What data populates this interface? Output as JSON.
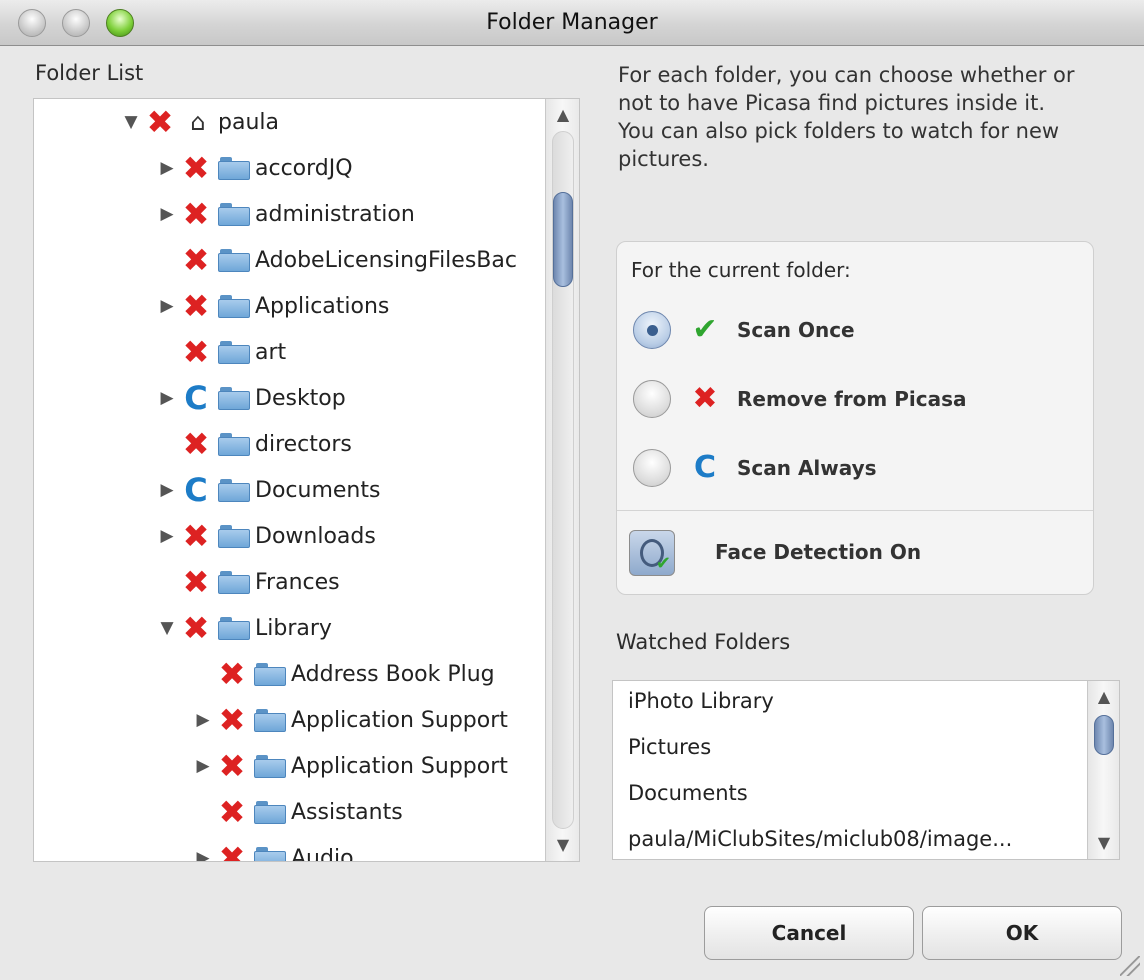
{
  "window": {
    "title": "Folder Manager"
  },
  "folder_list": {
    "label": "Folder List",
    "items": [
      {
        "name": "paula",
        "depth": 0,
        "disclosure": "expanded",
        "status": "remove",
        "icon": "home-icon"
      },
      {
        "name": "accordJQ",
        "depth": 1,
        "disclosure": "collapsed",
        "status": "remove",
        "icon": "folder-icon"
      },
      {
        "name": "administration",
        "depth": 1,
        "disclosure": "collapsed",
        "status": "remove",
        "icon": "folder-icon"
      },
      {
        "name": "AdobeLicensingFilesBac",
        "depth": 1,
        "disclosure": "none",
        "status": "remove",
        "icon": "folder-icon"
      },
      {
        "name": "Applications",
        "depth": 1,
        "disclosure": "collapsed",
        "status": "remove",
        "icon": "applications-folder-icon"
      },
      {
        "name": "art",
        "depth": 1,
        "disclosure": "none",
        "status": "remove",
        "icon": "folder-icon"
      },
      {
        "name": "Desktop",
        "depth": 1,
        "disclosure": "collapsed",
        "status": "scan-always",
        "icon": "desktop-folder-icon"
      },
      {
        "name": "directors",
        "depth": 1,
        "disclosure": "none",
        "status": "remove",
        "icon": "folder-icon"
      },
      {
        "name": "Documents",
        "depth": 1,
        "disclosure": "collapsed",
        "status": "scan-always",
        "icon": "documents-folder-icon"
      },
      {
        "name": "Downloads",
        "depth": 1,
        "disclosure": "collapsed",
        "status": "remove",
        "icon": "downloads-folder-icon"
      },
      {
        "name": "Frances",
        "depth": 1,
        "disclosure": "none",
        "status": "remove",
        "icon": "folder-icon"
      },
      {
        "name": "Library",
        "depth": 1,
        "disclosure": "expanded",
        "status": "remove",
        "icon": "library-folder-icon"
      },
      {
        "name": "Address Book Plug",
        "depth": 2,
        "disclosure": "none",
        "status": "remove",
        "icon": "folder-icon"
      },
      {
        "name": "Application Support",
        "depth": 2,
        "disclosure": "collapsed",
        "status": "remove",
        "icon": "folder-icon"
      },
      {
        "name": "Application Support",
        "depth": 2,
        "disclosure": "collapsed",
        "status": "remove",
        "icon": "folder-icon"
      },
      {
        "name": "Assistants",
        "depth": 2,
        "disclosure": "none",
        "status": "remove",
        "icon": "folder-icon"
      },
      {
        "name": "Audio",
        "depth": 2,
        "disclosure": "collapsed",
        "status": "remove",
        "icon": "folder-icon"
      }
    ]
  },
  "description": "For each folder, you can choose whether or not to have Picasa find pictures inside it.  You can also pick folders to watch for new pictures.",
  "current_folder": {
    "label": "For the current folder:",
    "options": [
      {
        "label": "Scan Once",
        "icon": "checkmark-icon",
        "selected": true,
        "color": "#2fa52f"
      },
      {
        "label": "Remove from Picasa",
        "icon": "x-icon",
        "selected": false,
        "color": "#dd2222"
      },
      {
        "label": "Scan Always",
        "icon": "refresh-icon",
        "selected": false,
        "color": "#1d7cc7"
      }
    ],
    "face_detection_label": "Face Detection On"
  },
  "watched_folders": {
    "label": "Watched Folders",
    "items": [
      "iPhoto Library",
      "Pictures",
      "Documents",
      "paula/MiClubSites/miclub08/image..."
    ]
  },
  "buttons": {
    "cancel": "Cancel",
    "ok": "OK"
  },
  "glyphs": {
    "disc_expanded": "▼",
    "disc_collapsed": "▶",
    "x": "✖",
    "scan": "C",
    "home": "⌂",
    "check": "✔",
    "up": "▲",
    "down": "▼"
  }
}
